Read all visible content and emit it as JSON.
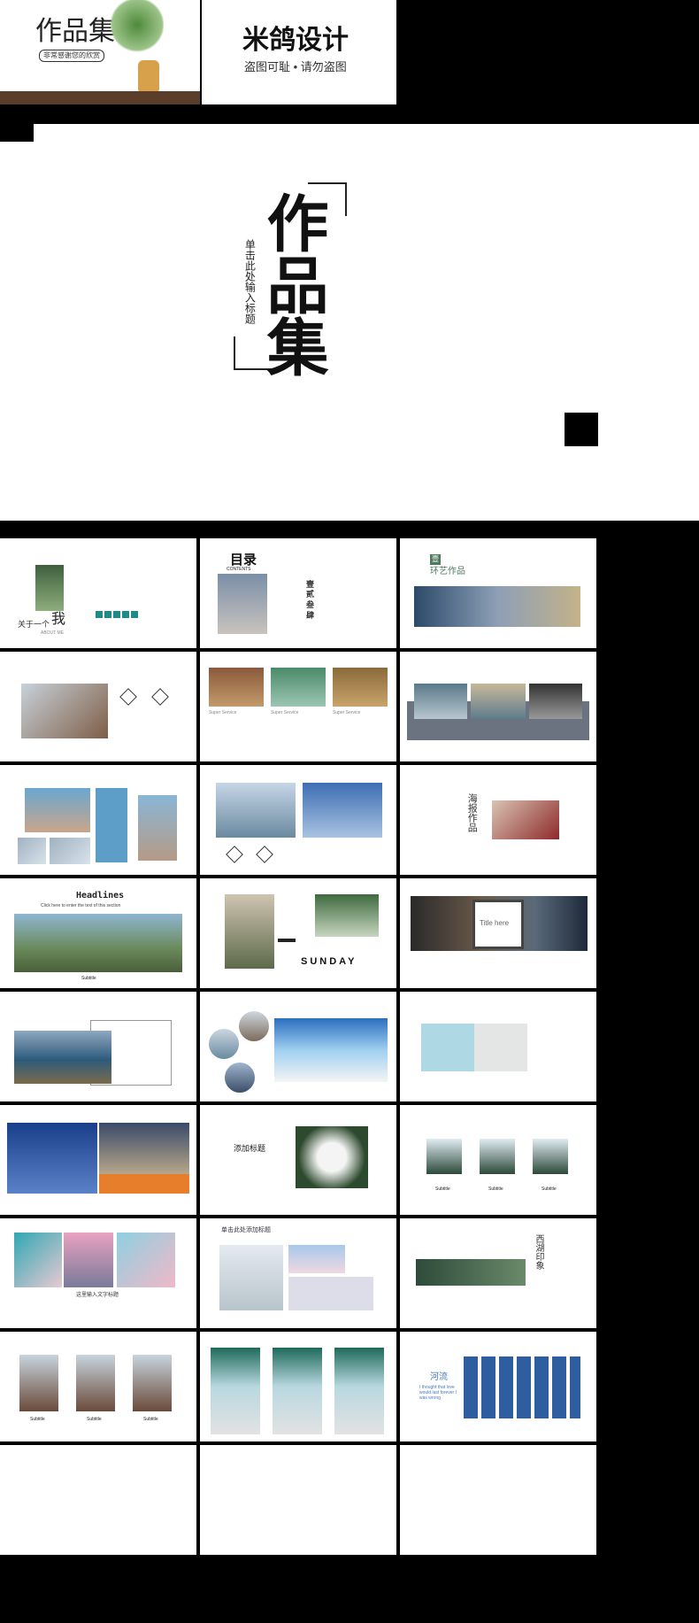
{
  "top": {
    "thumb1_title": "作品集",
    "thumb1_subtitle": "非常感谢您的欣赏",
    "thumb2_title": "米鸽设计",
    "thumb2_subtitle": "盗图可耻 • 请勿盗图"
  },
  "cover": {
    "title": "作品集",
    "subtitle": "单击此处输入标题"
  },
  "slides": {
    "about_label": "关于一个",
    "about_big": "我",
    "about_en": "ABOUT ME",
    "toc_title": "目录",
    "toc_en": "CONTENTS",
    "toc_items": [
      "壹",
      "贰",
      "叁",
      "肆"
    ],
    "s3_title": "环艺作品",
    "s3_num": "壹",
    "headlines": "Headlines",
    "headlines_sub": "Click here to enter the text of this section",
    "subtitle_label": "Subtitle",
    "sunday": "SUNDAY",
    "title_here": "Title here",
    "add_title": "添加标题",
    "poster_title": "海报作品",
    "west_lake": "西湖印象",
    "river": "河流",
    "river_text": "I thought that love would last forever I was wrong",
    "super_service": "Super Service",
    "placeholder_title": "单击此处添加标题",
    "pink_caption": "这里输入文字标题",
    "subtitles": [
      "Subtitle",
      "Subtitle",
      "Subtitle"
    ]
  }
}
